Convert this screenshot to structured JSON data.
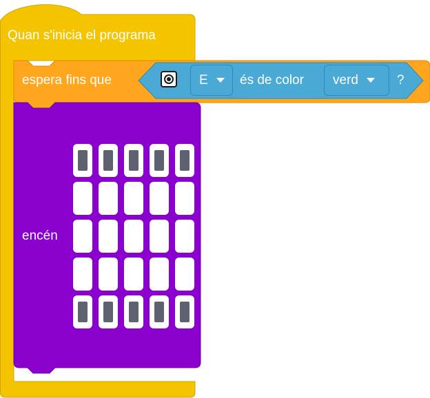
{
  "event_block": {
    "label": "Quan s'inicia el programa"
  },
  "wait_block": {
    "label": "espera fins que",
    "sensor_icon": "color-sensor-icon",
    "port": "E",
    "condition_text": "és de color",
    "color": "verd",
    "suffix": "?"
  },
  "light_block": {
    "label": "encén",
    "matrix": [
      [
        true,
        true,
        true,
        true,
        true
      ],
      [
        false,
        false,
        false,
        false,
        false
      ],
      [
        false,
        false,
        false,
        false,
        false
      ],
      [
        false,
        false,
        false,
        false,
        false
      ],
      [
        true,
        true,
        true,
        true,
        true
      ]
    ]
  },
  "colors": {
    "events_yellow": "#f5c400",
    "control_orange": "#ffa51e",
    "sensor_blue": "#4aa9d5",
    "light_purple": "#8a00cc",
    "led_on": "#5e6170"
  }
}
